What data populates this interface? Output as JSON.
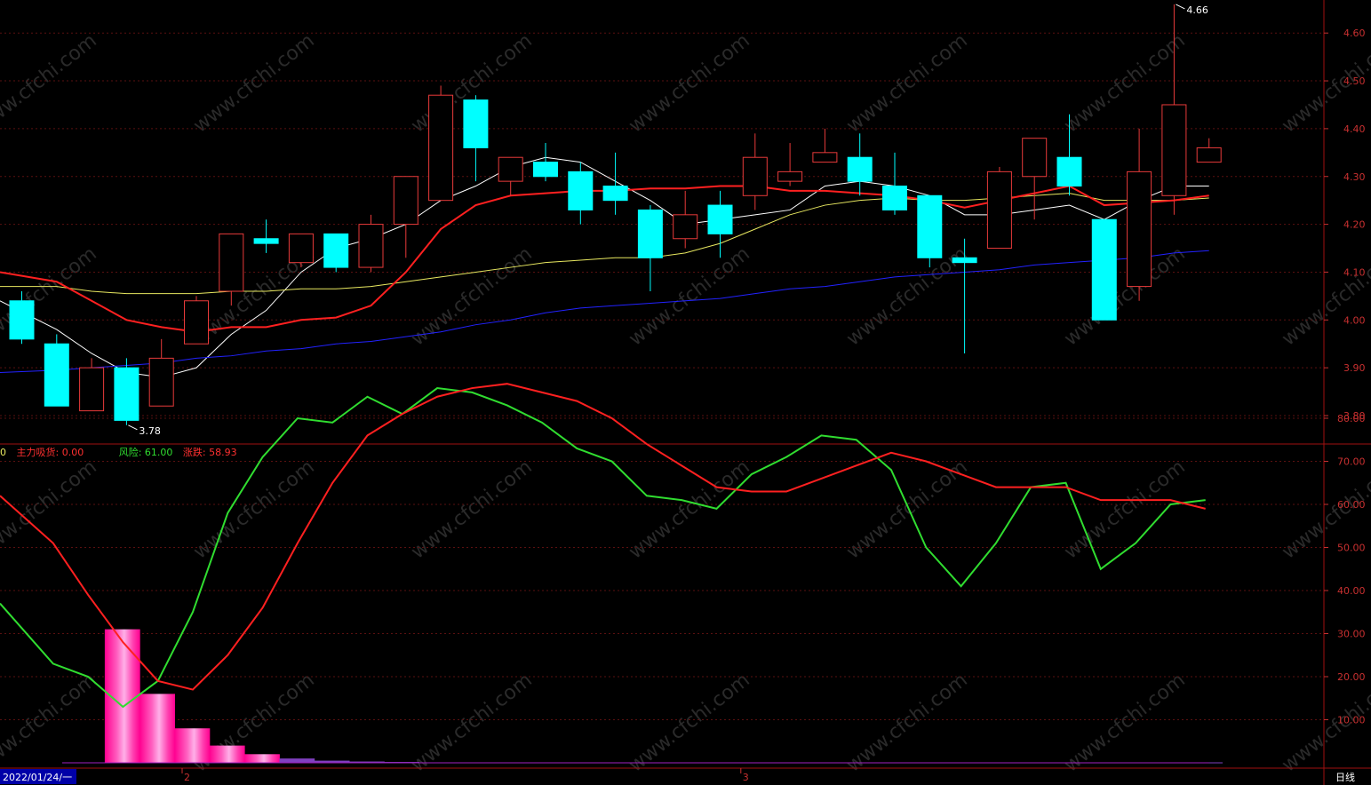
{
  "chart_data": [
    {
      "type": "candlestick",
      "title": "",
      "ylim": [
        3.75,
        4.67
      ],
      "yticks": [
        {
          "value": 4.6,
          "label": "4.60"
        },
        {
          "value": 4.5,
          "label": "4.50"
        },
        {
          "value": 4.4,
          "label": "4.40"
        },
        {
          "value": 4.3,
          "label": "4.30"
        },
        {
          "value": 4.2,
          "label": "4.20"
        },
        {
          "value": 4.1,
          "label": "4.10"
        },
        {
          "value": 4.0,
          "label": "4.00"
        },
        {
          "value": 3.9,
          "label": "3.90"
        },
        {
          "value": 3.8,
          "label": "3.80"
        }
      ],
      "candles": [
        {
          "o": 4.04,
          "h": 4.06,
          "c": 3.96,
          "l": 3.95
        },
        {
          "o": 3.95,
          "h": 3.97,
          "c": 3.82,
          "l": 3.82
        },
        {
          "o": 3.81,
          "h": 3.92,
          "c": 3.9,
          "l": 3.81
        },
        {
          "o": 3.9,
          "h": 3.92,
          "c": 3.79,
          "l": 3.78
        },
        {
          "o": 3.82,
          "h": 3.96,
          "c": 3.92,
          "l": 3.82
        },
        {
          "o": 3.95,
          "h": 4.05,
          "c": 4.04,
          "l": 3.95
        },
        {
          "o": 4.06,
          "h": 4.18,
          "c": 4.18,
          "l": 4.03
        },
        {
          "o": 4.17,
          "h": 4.21,
          "c": 4.16,
          "l": 4.14
        },
        {
          "o": 4.12,
          "h": 4.18,
          "c": 4.18,
          "l": 4.11
        },
        {
          "o": 4.18,
          "h": 4.18,
          "c": 4.11,
          "l": 4.1
        },
        {
          "o": 4.11,
          "h": 4.22,
          "c": 4.2,
          "l": 4.1
        },
        {
          "o": 4.2,
          "h": 4.27,
          "c": 4.3,
          "l": 4.13
        },
        {
          "o": 4.25,
          "h": 4.49,
          "c": 4.47,
          "l": 4.25
        },
        {
          "o": 4.46,
          "h": 4.47,
          "c": 4.36,
          "l": 4.29
        },
        {
          "o": 4.29,
          "h": 4.34,
          "c": 4.34,
          "l": 4.26
        },
        {
          "o": 4.33,
          "h": 4.37,
          "c": 4.3,
          "l": 4.29
        },
        {
          "o": 4.31,
          "h": 4.33,
          "c": 4.23,
          "l": 4.2
        },
        {
          "o": 4.28,
          "h": 4.35,
          "c": 4.25,
          "l": 4.22
        },
        {
          "o": 4.23,
          "h": 4.24,
          "c": 4.13,
          "l": 4.06
        },
        {
          "o": 4.17,
          "h": 4.27,
          "c": 4.22,
          "l": 4.15
        },
        {
          "o": 4.24,
          "h": 4.27,
          "c": 4.18,
          "l": 4.13
        },
        {
          "o": 4.26,
          "h": 4.39,
          "c": 4.34,
          "l": 4.23
        },
        {
          "o": 4.29,
          "h": 4.37,
          "c": 4.31,
          "l": 4.28
        },
        {
          "o": 4.33,
          "h": 4.4,
          "c": 4.35,
          "l": 4.33
        },
        {
          "o": 4.34,
          "h": 4.39,
          "c": 4.29,
          "l": 4.26
        },
        {
          "o": 4.28,
          "h": 4.35,
          "c": 4.23,
          "l": 4.22
        },
        {
          "o": 4.26,
          "h": 4.26,
          "c": 4.13,
          "l": 4.11
        },
        {
          "o": 4.13,
          "h": 4.17,
          "c": 4.12,
          "l": 3.93
        },
        {
          "o": 4.15,
          "h": 4.32,
          "c": 4.31,
          "l": 4.15
        },
        {
          "o": 4.3,
          "h": 4.38,
          "c": 4.38,
          "l": 4.21
        },
        {
          "o": 4.34,
          "h": 4.43,
          "c": 4.28,
          "l": 4.26
        },
        {
          "o": 4.21,
          "h": 4.21,
          "c": 4.0,
          "l": 4.0
        },
        {
          "o": 4.07,
          "h": 4.4,
          "c": 4.31,
          "l": 4.04
        },
        {
          "o": 4.26,
          "h": 4.66,
          "c": 4.45,
          "l": 4.22
        },
        {
          "o": 4.33,
          "h": 4.38,
          "c": 4.36,
          "l": 4.33
        }
      ],
      "ma_lines": [
        {
          "color": "#ffffff",
          "values": [
            4.04,
            3.98,
            3.93,
            3.89,
            3.88,
            3.9,
            3.97,
            4.02,
            4.1,
            4.15,
            4.17,
            4.2,
            4.25,
            4.28,
            4.32,
            4.34,
            4.33,
            4.29,
            4.25,
            4.2,
            4.21,
            4.22,
            4.23,
            4.28,
            4.29,
            4.28,
            4.26,
            4.22,
            4.22,
            4.23,
            4.24,
            4.21,
            4.25,
            4.28,
            4.28
          ]
        },
        {
          "color": "#e8e860",
          "values": [
            4.07,
            4.07,
            4.06,
            4.055,
            4.055,
            4.055,
            4.06,
            4.06,
            4.065,
            4.065,
            4.07,
            4.08,
            4.09,
            4.1,
            4.11,
            4.12,
            4.125,
            4.13,
            4.13,
            4.14,
            4.16,
            4.19,
            4.22,
            4.24,
            4.25,
            4.255,
            4.25,
            4.25,
            4.255,
            4.26,
            4.265,
            4.25,
            4.25,
            4.25,
            4.255
          ]
        },
        {
          "color": "#ff2020",
          "values": [
            4.1,
            4.08,
            4.04,
            4.0,
            3.985,
            3.975,
            3.985,
            3.985,
            4.0,
            4.005,
            4.03,
            4.1,
            4.19,
            4.24,
            4.26,
            4.265,
            4.27,
            4.27,
            4.275,
            4.275,
            4.28,
            4.28,
            4.27,
            4.27,
            4.265,
            4.26,
            4.25,
            4.235,
            4.25,
            4.265,
            4.28,
            4.24,
            4.245,
            4.25,
            4.26
          ]
        },
        {
          "color": "#2222ff",
          "values": [
            3.89,
            3.895,
            3.9,
            3.905,
            3.91,
            3.92,
            3.925,
            3.935,
            3.94,
            3.95,
            3.955,
            3.965,
            3.975,
            3.99,
            4.0,
            4.015,
            4.025,
            4.03,
            4.035,
            4.04,
            4.045,
            4.055,
            4.065,
            4.07,
            4.08,
            4.09,
            4.095,
            4.1,
            4.105,
            4.115,
            4.12,
            4.125,
            4.13,
            4.14,
            4.145
          ]
        }
      ],
      "annotations": [
        {
          "label": "4.66",
          "value": 4.66,
          "index": 33
        },
        {
          "label": "3.78",
          "value": 3.78,
          "index": 3
        }
      ]
    },
    {
      "type": "line",
      "title": "",
      "ylim": [
        0,
        92
      ],
      "yticks": [
        {
          "value": 80,
          "label": "80.00"
        },
        {
          "value": 70,
          "label": "70.00"
        },
        {
          "value": 60,
          "label": "60.00"
        },
        {
          "value": 50,
          "label": "50.00"
        },
        {
          "value": 40,
          "label": "40.00"
        },
        {
          "value": 30,
          "label": "30.00"
        },
        {
          "value": 20,
          "label": "20.00"
        },
        {
          "value": 10,
          "label": "10.00"
        }
      ],
      "legend": [
        {
          "text": "0",
          "color": "#e8e860"
        },
        {
          "text": "主力吸货: 0.00",
          "color": "#ff3030"
        },
        {
          "text": "风险: 61.00",
          "color": "#30dd30"
        },
        {
          "text": "涨跌: 58.93",
          "color": "#ff3030"
        }
      ],
      "series": [
        {
          "name": "风险",
          "color": "#30dd30",
          "values": [
            37,
            23,
            20,
            13,
            19,
            35,
            58,
            71,
            80,
            79,
            85,
            81,
            87,
            86,
            83,
            79,
            73,
            70,
            62,
            61,
            59,
            67,
            71,
            76,
            75,
            68,
            50,
            41,
            51,
            64,
            65,
            45,
            51,
            60,
            61
          ]
        },
        {
          "name": "涨跌",
          "color": "#ff2020",
          "values": [
            62,
            51,
            39,
            28,
            19,
            17,
            25,
            36,
            51,
            65,
            76,
            81,
            85,
            87,
            88,
            86,
            84,
            80,
            74,
            69,
            64,
            63,
            63,
            66,
            69,
            72,
            70,
            67,
            64,
            64,
            64,
            61,
            61,
            61,
            59
          ]
        }
      ],
      "bars": {
        "name": "主力吸货",
        "values": [
          0,
          0,
          0,
          31,
          16,
          8,
          4,
          2,
          1,
          0.5,
          0.3,
          0.2,
          0.1,
          0.1,
          0.1,
          0.1,
          0.1,
          0.1,
          0.1,
          0.1,
          0.1,
          0.1,
          0.1,
          0.1,
          0.1,
          0.1,
          0.1,
          0.1,
          0.1,
          0.1,
          0.1,
          0.1,
          0.1,
          0.1,
          0.1
        ]
      }
    }
  ],
  "footer": {
    "date_label": "2022/01/24/一",
    "month_marks": [
      {
        "label": "2",
        "index": 5
      },
      {
        "label": "3",
        "index": 21
      }
    ],
    "period_label": "日线"
  },
  "watermark": "www.cfchi.com"
}
